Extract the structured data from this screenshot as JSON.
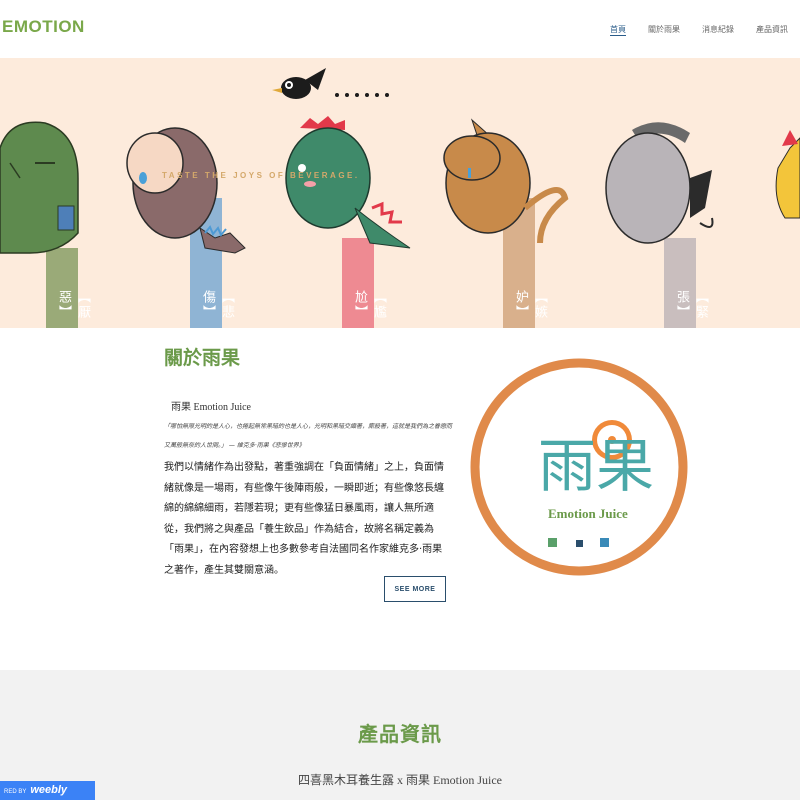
{
  "header": {
    "logo": "EMOTION",
    "nav": [
      {
        "label": "首頁",
        "active": true
      },
      {
        "label": "關於雨果",
        "active": false
      },
      {
        "label": "消息紀錄",
        "active": false
      },
      {
        "label": "產品資訊",
        "active": false
      }
    ]
  },
  "hero": {
    "tagline": "TASTE THE JOYS OF BEVERAGE.",
    "pillars": [
      {
        "label": "【厭惡】",
        "color": "#9aaa78"
      },
      {
        "label": "【悲傷】",
        "color": "#8fb4d4"
      },
      {
        "label": "【尷尬】",
        "color": "#ee8a92"
      },
      {
        "label": "【嫉妒】",
        "color": "#d9b08c"
      },
      {
        "label": "【緊張】",
        "color": "#c9bebe"
      }
    ]
  },
  "about": {
    "title": "關於雨果",
    "subtitle": "雨果 Emotion Juice",
    "quote": "「哪怕無限光明的是人心，也捲起無常黑暗的也是人心，光明和黑暗交織著，廝殺著，這就是我們為之眷戀而又萬般無奈的人世間。」 — 維克多·雨果《悲慘世界》",
    "body": "我們以情緒作為出發點，著重強調在「負面情緒」之上，負面情緒就像是一場雨，有些像午後陣雨般，一瞬即逝；有些像悠長纏綿的綿綿細雨，若隱若現；更有些像猛日暴風雨，讓人無所適從，我們將之與產品「養生飲品」作為結合，故將名稱定義為「雨果」，在內容發想上也多數參考自法國同名作家維克多·雨果之著作，產生其雙關意涵。",
    "button": "SEE MORE",
    "badge_text": "Emotion Juice",
    "badge_logo": "雨果"
  },
  "products": {
    "title": "產品資訊",
    "subtitle": "四喜黑木耳養生露 x 雨果 Emotion Juice"
  },
  "footer": {
    "badge_prefix": "RED BY",
    "badge_brand": "weebly"
  },
  "colors": {
    "accent_green": "#6b9a4a",
    "navy": "#2a4e6c",
    "hero_bg": "#fdebdc"
  }
}
